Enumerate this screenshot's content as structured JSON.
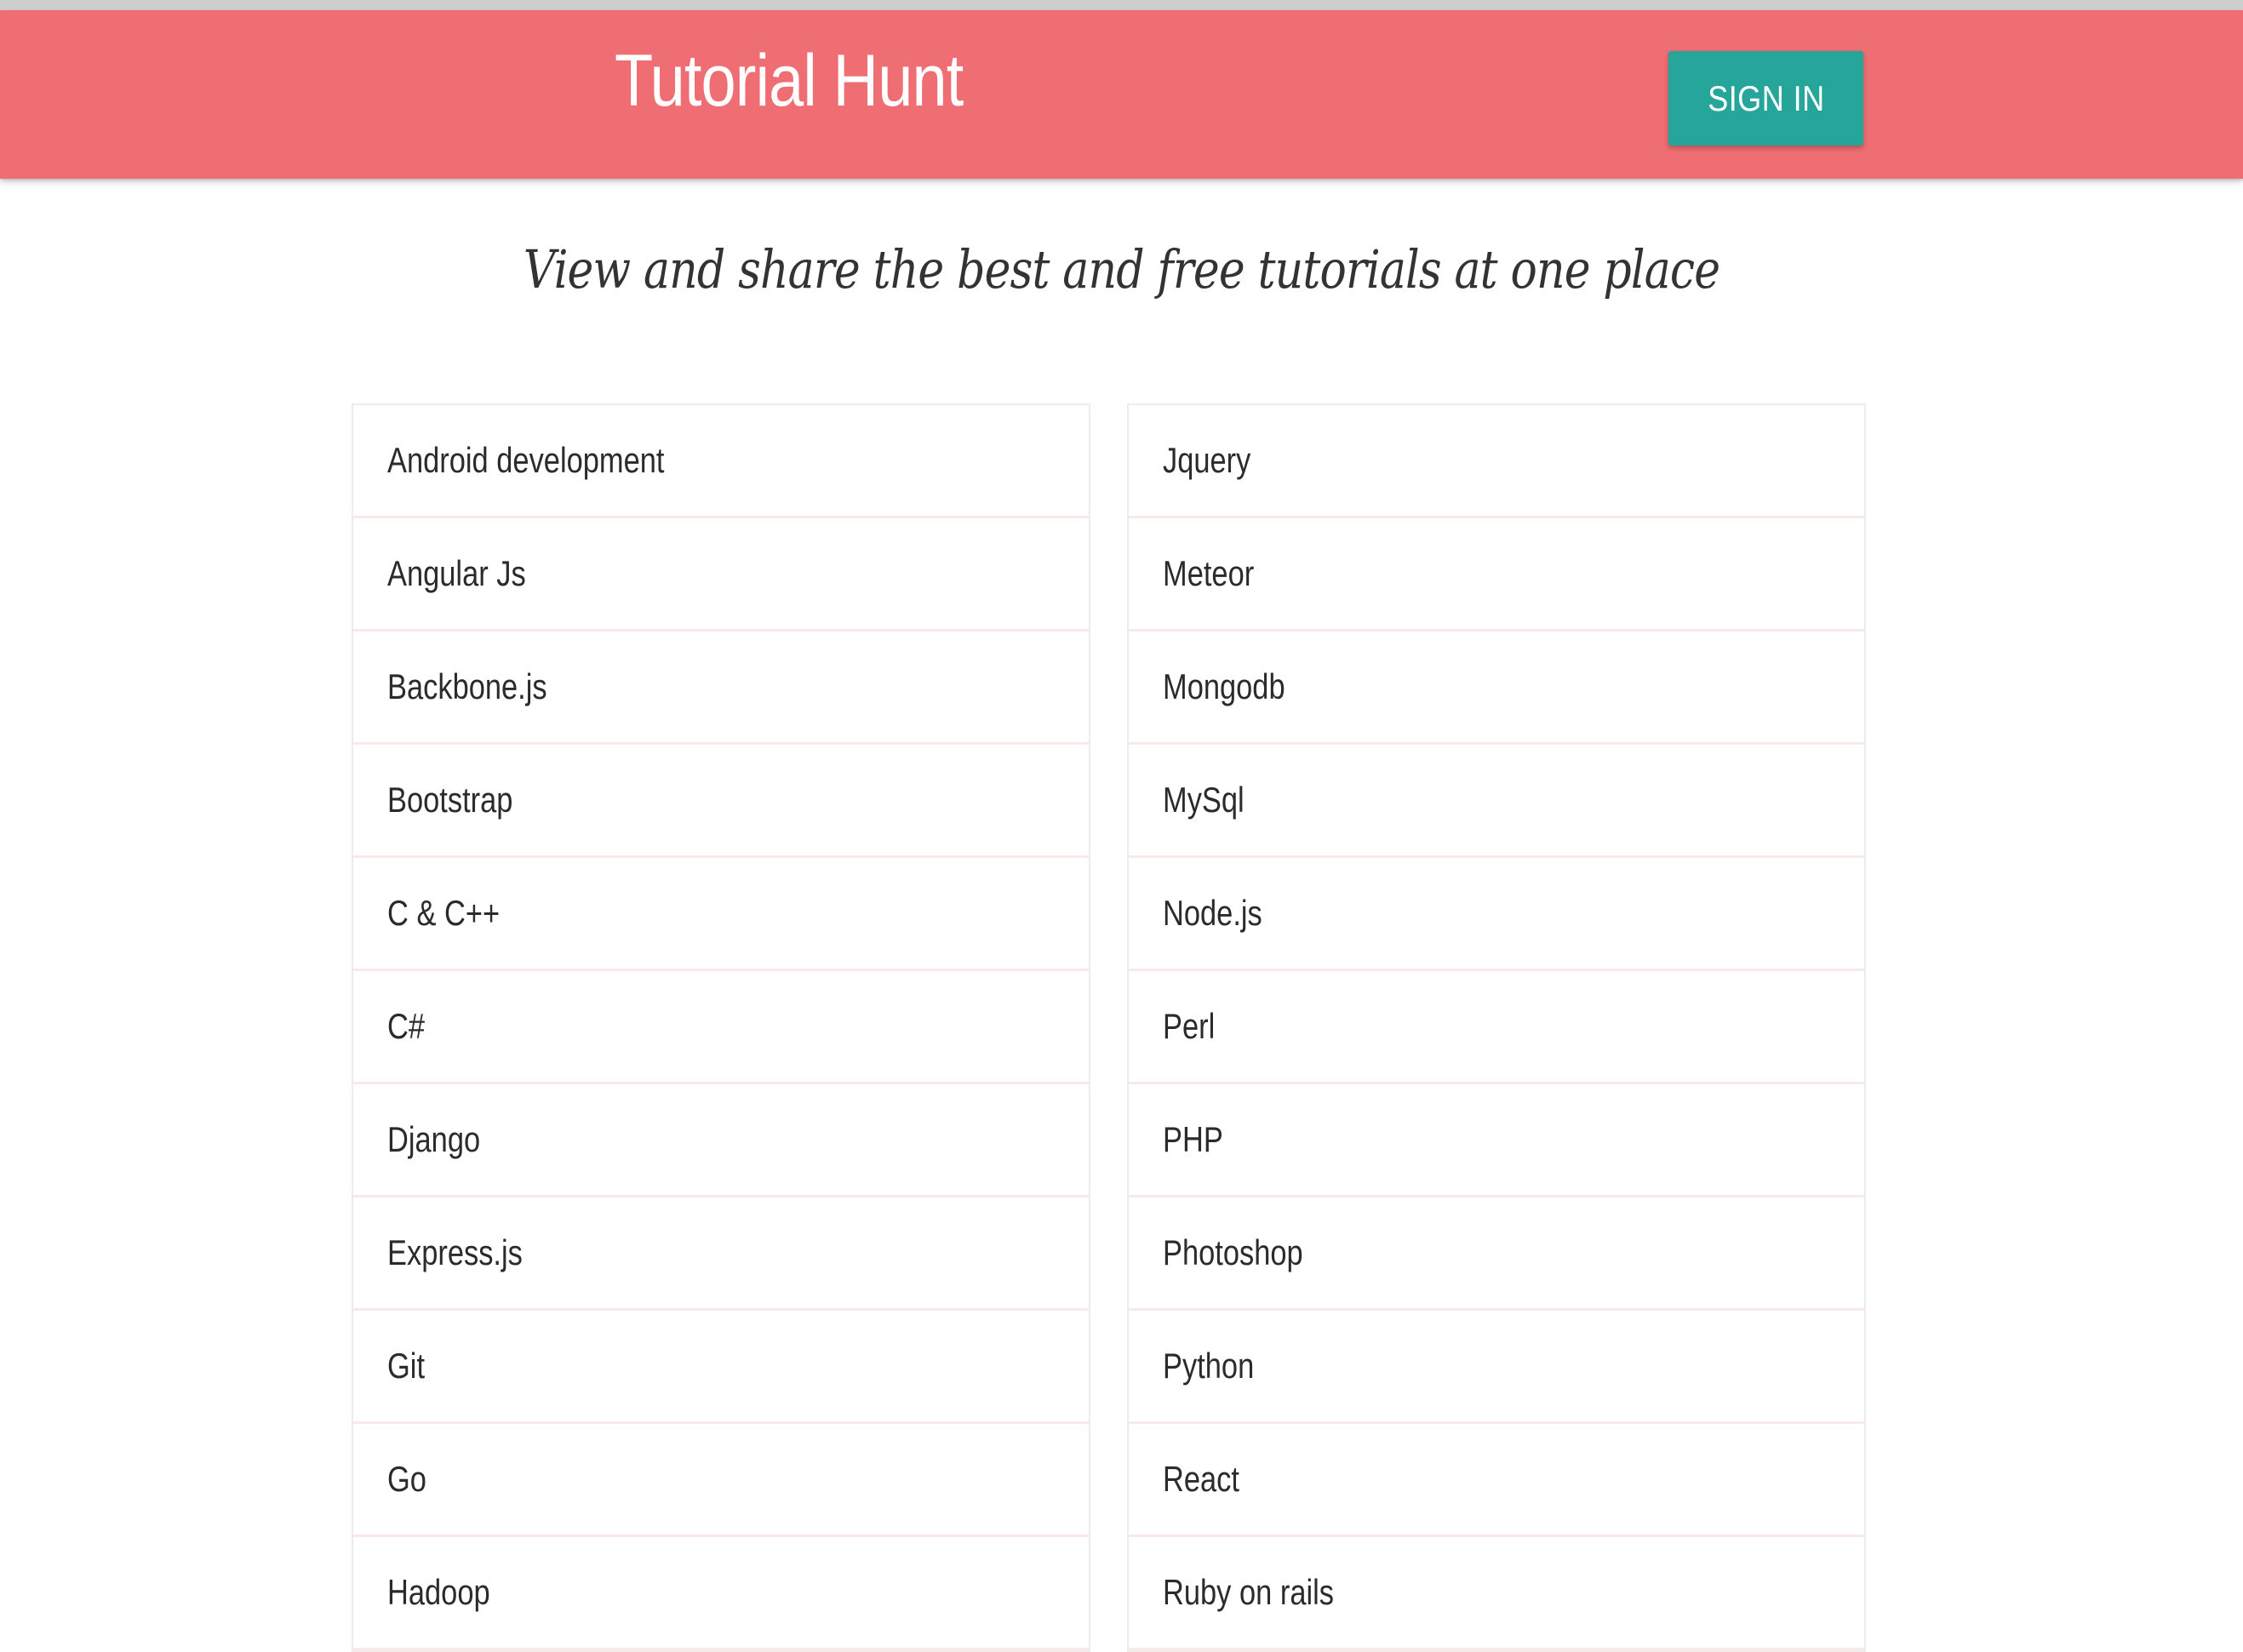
{
  "navbar": {
    "brand": "Tutorial Hunt",
    "sign_in_label": "SIGN IN"
  },
  "tagline": "View and share the best and free tutorials at one place",
  "lists": {
    "left": [
      "Android development",
      "Angular Js",
      "Backbone.js",
      "Bootstrap",
      "C & C++",
      "C#",
      "Django",
      "Express.js",
      "Git",
      "Go",
      "Hadoop"
    ],
    "right": [
      "Jquery",
      "Meteor",
      "Mongodb",
      "MySql",
      "Node.js",
      "Perl",
      "PHP",
      "Photoshop",
      "Python",
      "React",
      "Ruby on rails"
    ]
  },
  "colors": {
    "navbar": "#ee6e73",
    "button": "#26a69a"
  }
}
